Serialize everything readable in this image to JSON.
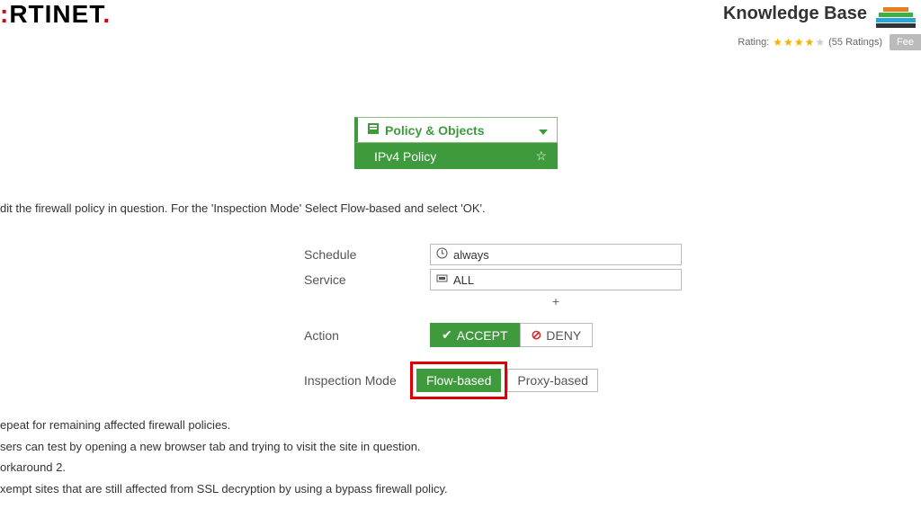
{
  "header": {
    "logo": "RTINET",
    "kb_title": "Knowledge Base",
    "rating_label": "Rating:",
    "rating_count": "(55 Ratings)",
    "feedback_btn": "Fee"
  },
  "nav": {
    "parent": "Policy & Objects",
    "child": "IPv4 Policy"
  },
  "instruction1": "dit the firewall policy in question. For the 'Inspection Mode' Select Flow-based and select 'OK'.",
  "form": {
    "schedule_label": "Schedule",
    "schedule_value": "always",
    "service_label": "Service",
    "service_value": "ALL",
    "plus": "+",
    "action_label": "Action",
    "accept": "ACCEPT",
    "deny": "DENY",
    "inspection_label": "Inspection Mode",
    "flow": "Flow-based",
    "proxy": "Proxy-based"
  },
  "bottom": {
    "l1": "epeat for remaining affected firewall policies.",
    "l2": "sers can test by opening a new browser tab and trying to visit the site in question.",
    "l3": "orkaround 2.",
    "l4": "xempt sites that are still affected from SSL decryption by using a bypass firewall policy."
  }
}
